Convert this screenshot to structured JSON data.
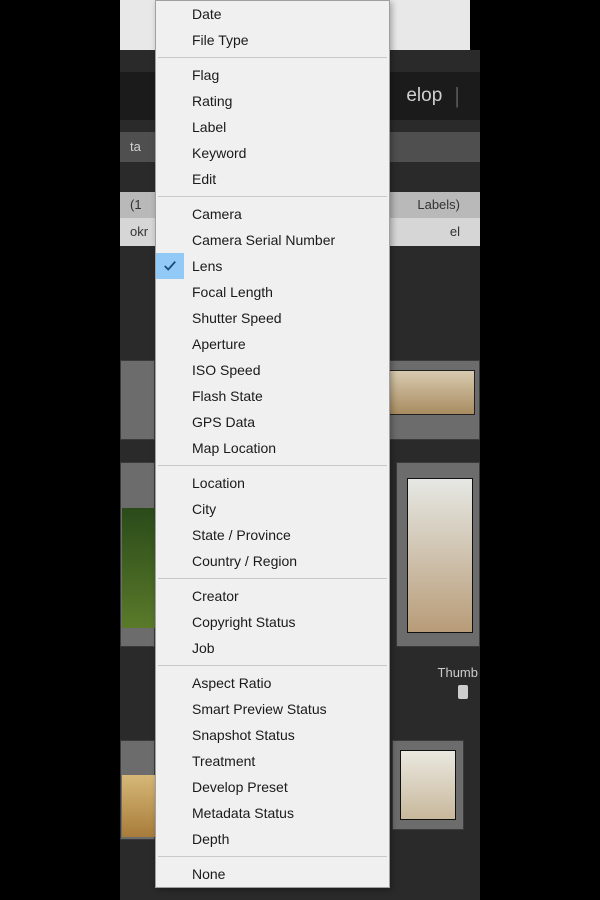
{
  "nav": {
    "module": "elop"
  },
  "toolbar": {
    "label_fragment_left": "ta",
    "count_fragment": "(1",
    "labels_text": "Labels)",
    "row3_left": "okr",
    "row3_right": "el"
  },
  "thumbnails": {
    "label": "Thumb"
  },
  "menu": {
    "groups": [
      {
        "items": [
          "Date",
          "File Type"
        ]
      },
      {
        "items": [
          "Flag",
          "Rating",
          "Label",
          "Keyword",
          "Edit"
        ]
      },
      {
        "items": [
          "Camera",
          "Camera Serial Number",
          "Lens",
          "Focal Length",
          "Shutter Speed",
          "Aperture",
          "ISO Speed",
          "Flash State",
          "GPS Data",
          "Map Location"
        ]
      },
      {
        "items": [
          "Location",
          "City",
          "State / Province",
          "Country / Region"
        ]
      },
      {
        "items": [
          "Creator",
          "Copyright Status",
          "Job"
        ]
      },
      {
        "items": [
          "Aspect Ratio",
          "Smart Preview Status",
          "Snapshot Status",
          "Treatment",
          "Develop Preset",
          "Metadata Status",
          "Depth"
        ]
      },
      {
        "items": [
          "None"
        ]
      }
    ],
    "checked": "Lens"
  }
}
